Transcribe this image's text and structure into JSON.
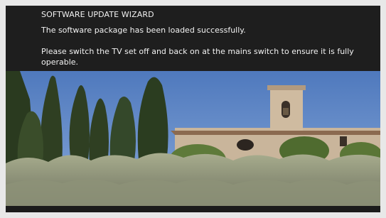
{
  "wizard": {
    "title": "SOFTWARE UPDATE WIZARD",
    "message_success": "The software package has been loaded successfully.",
    "message_instruction": "Please switch the TV set off and back on at the mains switch to ensure it is fully operable."
  },
  "colors": {
    "panel_background": "#1e1e1e",
    "text": "#f2f2f2",
    "sky": "#5f86c4"
  }
}
